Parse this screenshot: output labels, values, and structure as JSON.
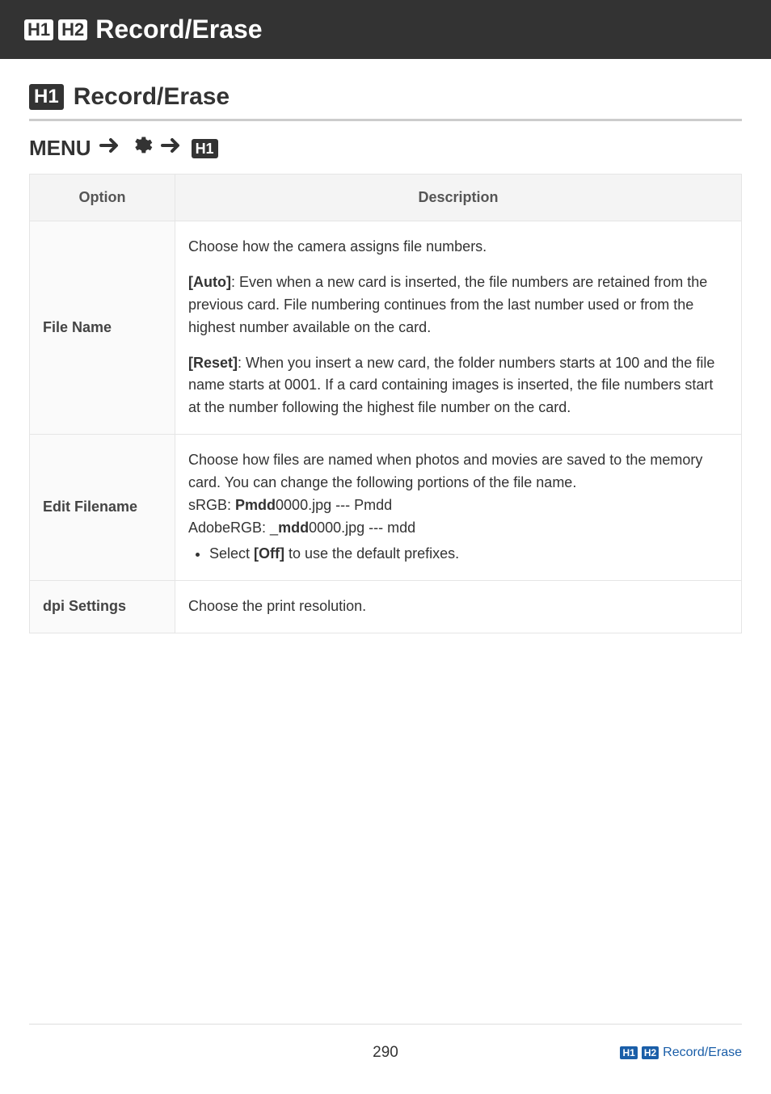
{
  "header": {
    "tag1": "H1",
    "tag2": "H2",
    "title": "Record/Erase"
  },
  "section": {
    "tag": "H1",
    "title": "Record/Erase"
  },
  "breadcrumb": {
    "menu": "MENU",
    "tag": "H1"
  },
  "table": {
    "headers": {
      "option": "Option",
      "description": "Description"
    },
    "rows": {
      "filename": {
        "option": "File Name",
        "intro": "Choose how the camera assigns file numbers.",
        "auto_label": "[Auto]",
        "auto_text": ": Even when a new card is inserted, the file numbers are retained from the previous card. File numbering continues from the last number used or from the highest number available on the card.",
        "reset_label": "[Reset]",
        "reset_text": ": When you insert a new card, the folder numbers starts at 100 and the file name starts at 0001. If a card containing images is inserted, the file numbers start at the number following the highest file number on the card."
      },
      "editfilename": {
        "option": "Edit Filename",
        "line1": "Choose how files are named when photos and movies are saved to the memory card. You can change the following portions of the file name.",
        "srgb_prefix": "sRGB: ",
        "srgb_bold": "Pmdd",
        "srgb_rest": "0000.jpg --- Pmdd",
        "adobe_prefix": "AdobeRGB: _",
        "adobe_bold": "mdd",
        "adobe_rest": "0000.jpg --- mdd",
        "bullet_prefix": "Select ",
        "bullet_bold": "[Off]",
        "bullet_rest": " to use the default prefixes."
      },
      "dpi": {
        "option": "dpi Settings",
        "desc": "Choose the print resolution."
      }
    }
  },
  "footer": {
    "page": "290",
    "tag1": "H1",
    "tag2": "H2",
    "link": "Record/Erase"
  }
}
